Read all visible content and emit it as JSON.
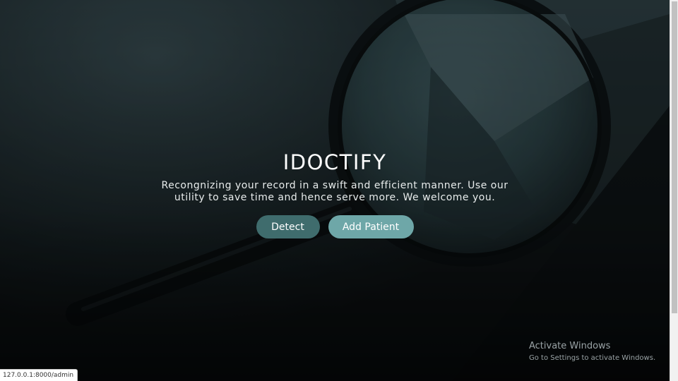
{
  "hero": {
    "title": "IDOCTIFY",
    "description": "Recongnizing your record in a swift and efficient manner. Use our utility to save time and hence serve more. We welcome you.",
    "buttons": {
      "detect_label": "Detect",
      "add_patient_label": "Add Patient"
    }
  },
  "windows_watermark": {
    "title": "Activate Windows",
    "subtitle": "Go to Settings to activate Windows."
  },
  "status_bar": {
    "url": "127.0.0.1:8000/admin"
  },
  "colors": {
    "detect_button": "#3f6c6d",
    "add_patient_button": "#6ea7a8",
    "background_dark": "#131a1d"
  },
  "icons": {
    "background_image": "magnifying-glass-photo"
  }
}
